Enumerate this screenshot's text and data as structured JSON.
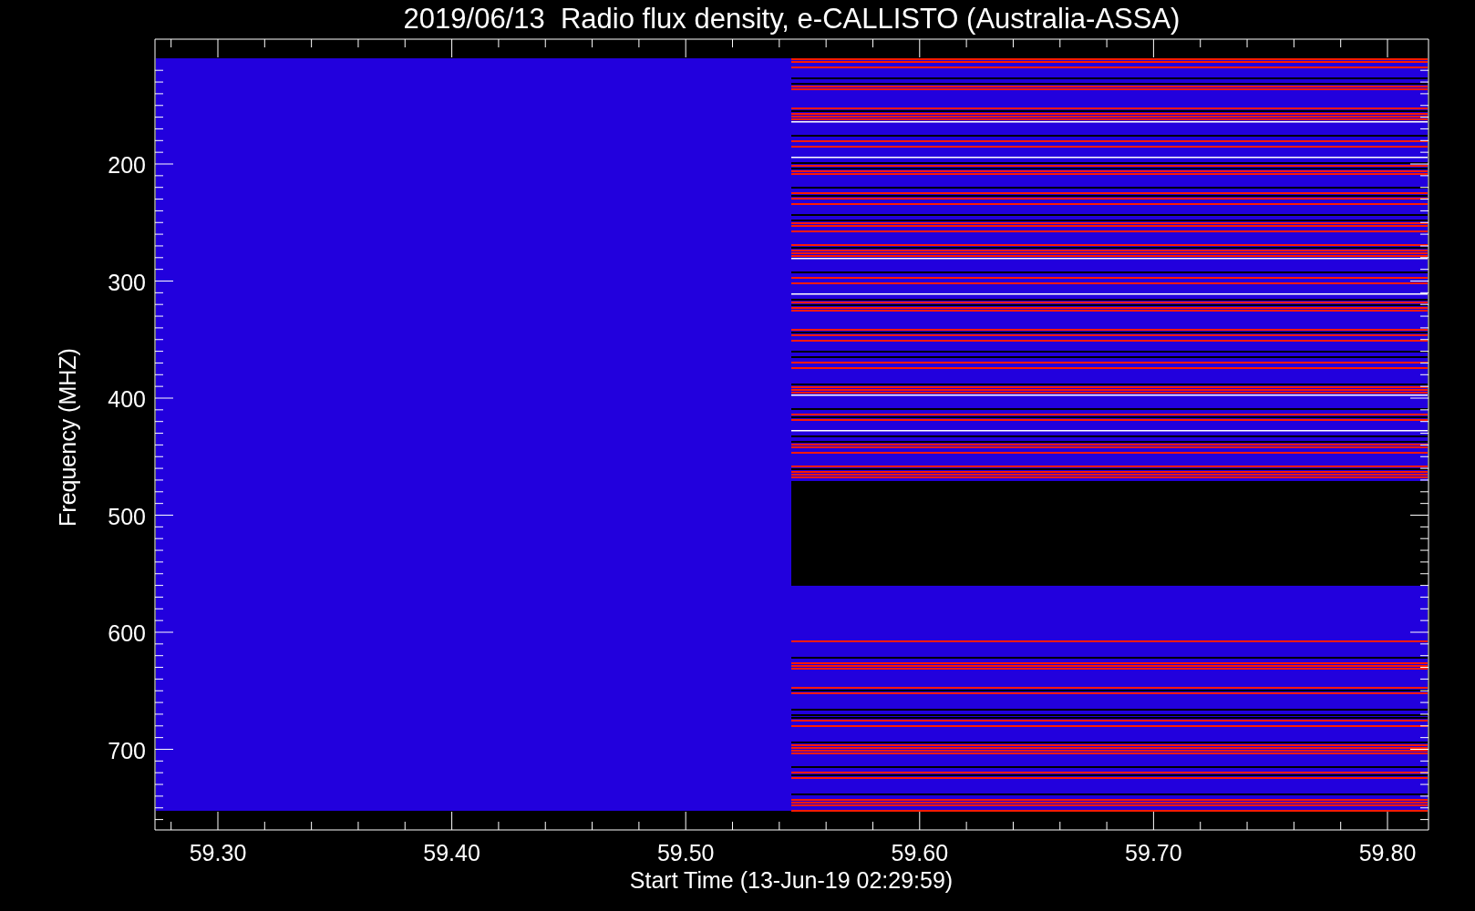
{
  "plot": {
    "title": "2019/06/13  Radio flux density, e-CALLISTO (Australia-ASSA)",
    "ylabel": "Frequency (MHZ)",
    "xlabel": "Start Time (13-Jun-19 02:29:59)",
    "yticks": [
      "200",
      "300",
      "400",
      "500",
      "600",
      "700"
    ],
    "xticks": [
      "59.30",
      "59.40",
      "59.50",
      "59.60",
      "59.70",
      "59.80"
    ]
  }
}
